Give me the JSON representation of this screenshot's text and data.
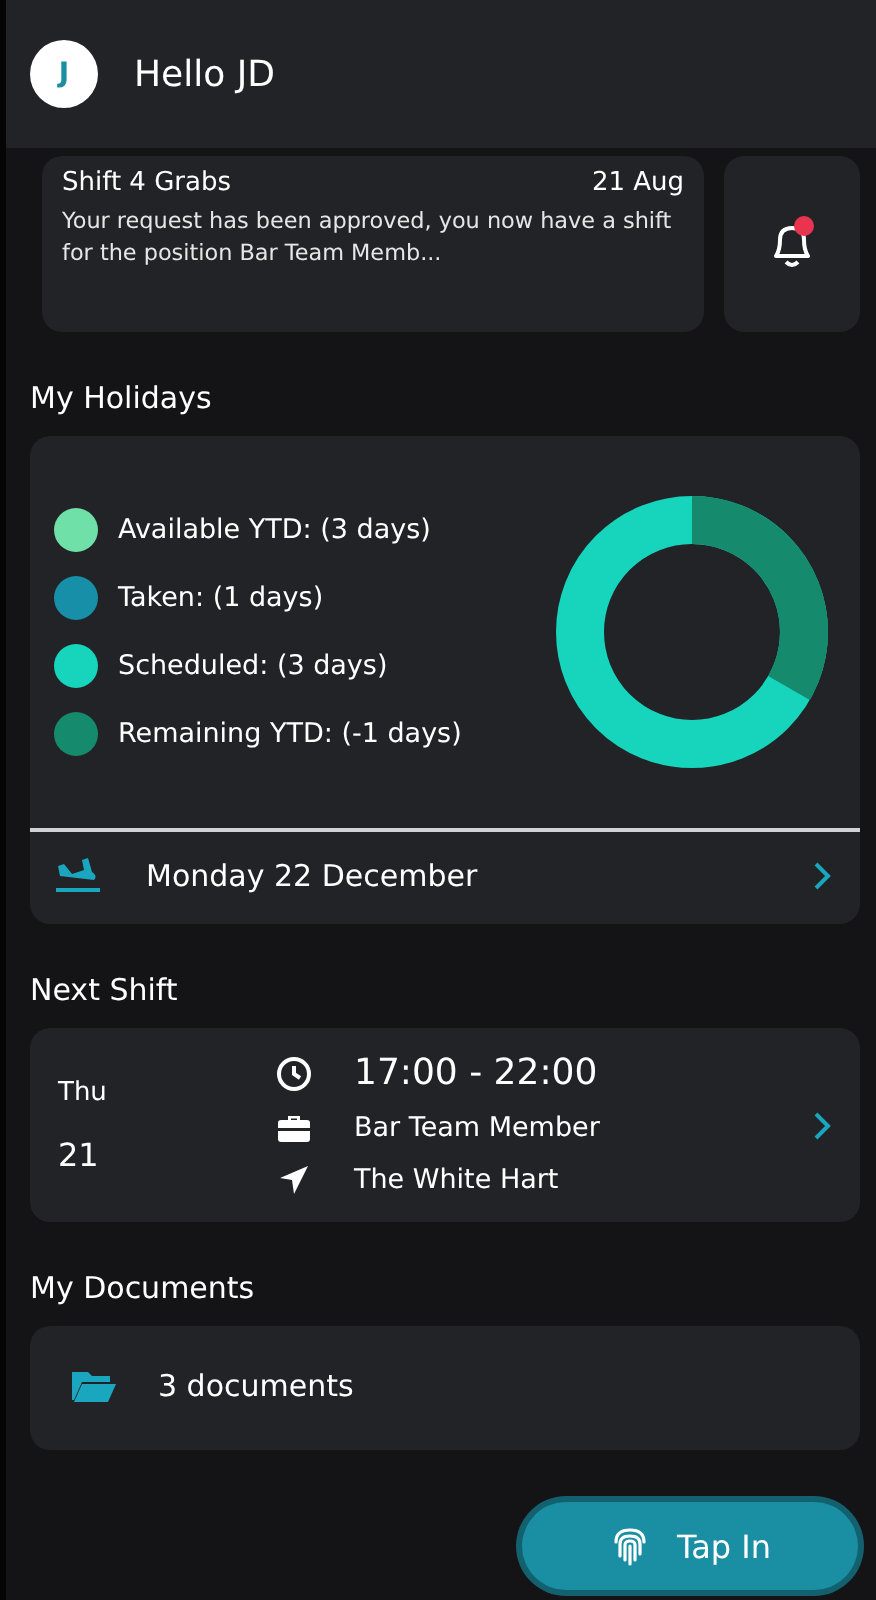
{
  "header": {
    "avatar_initial": "J",
    "greeting": "Hello JD"
  },
  "notification": {
    "title": "Shift 4 Grabs",
    "date": "21 Aug",
    "message": "Your request has been approved, you now have a shift for the position Bar Team Memb...",
    "unread": true
  },
  "holidays": {
    "title": "My Holidays",
    "legend": [
      {
        "label": "Available YTD: (3 days)",
        "color": "#6ee0a8"
      },
      {
        "label": "Taken: (1 days)",
        "color": "#178fa8"
      },
      {
        "label": "Scheduled: (3 days)",
        "color": "#17d4bc"
      },
      {
        "label": "Remaining YTD: (-1 days)",
        "color": "#158a6c"
      }
    ],
    "next_holiday": "Monday 22 December"
  },
  "next_shift": {
    "title": "Next Shift",
    "day": "Thu",
    "date": "21",
    "time": "17:00 - 22:00",
    "role": "Bar Team Member",
    "location": "The White Hart"
  },
  "documents": {
    "title": "My Documents",
    "count": "3 documents"
  },
  "tap_in": {
    "label": "Tap In"
  }
}
